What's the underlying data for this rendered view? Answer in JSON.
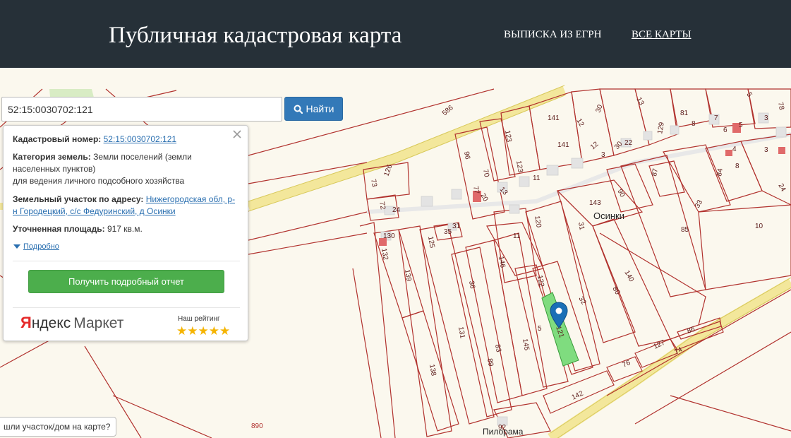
{
  "header": {
    "title": "Публичная кадастровая карта",
    "nav": {
      "egrn": "ВЫПИСКА ИЗ ЕГРН",
      "all_maps": "ВСЕ КАРТЫ"
    }
  },
  "search": {
    "value": "52:15:0030702:121",
    "button": "Найти"
  },
  "popup": {
    "cadastral_label": "Кадастровый номер:",
    "cadastral_value": "52:15:0030702:121",
    "category_label": "Категория земель:",
    "category_value": "Земли поселений (земли населенных пунктов)",
    "category_use": "для ведения личного подсобного хозяйства",
    "address_label": "Земельный участок по адресу:",
    "address_value": "Нижегородская обл, р-н Городецкий, с/с Федуринский, д Осинки",
    "area_label": "Уточненная площадь:",
    "area_value": "917 кв.м.",
    "more": "Подробно",
    "report_button": "Получить подробный отчет",
    "ym_y": "Я",
    "ym_ndex": "ндекс",
    "ym_market": "Маркет",
    "rating_label": "Наш рейтинг",
    "stars": "★★★★★"
  },
  "map": {
    "settlement": "Осинки",
    "pilorama": "Пилорама",
    "hint": "шли участок/дом на карте?",
    "bottom_number": "890",
    "parcel_labels": [
      "586",
      "141",
      "12",
      "30",
      "13",
      "5",
      "78",
      "81",
      "7",
      "5",
      "3",
      "129",
      "8",
      "6",
      "123",
      "141",
      "12",
      "13",
      "30",
      "22",
      "4",
      "8",
      "3",
      "96",
      "70",
      "123",
      "11",
      "87",
      "84",
      "24",
      "126",
      "73",
      "77",
      "20",
      "13",
      "143",
      "90",
      "72",
      "24",
      "120",
      "11",
      "31",
      "33",
      "85",
      "10",
      "35",
      "31",
      "125",
      "130",
      "132",
      "139",
      "146",
      "122",
      "36",
      "140",
      "80",
      "32",
      "131",
      "138",
      "83",
      "89",
      "5",
      "145",
      "121",
      "86",
      "74",
      "127",
      "76",
      "142",
      "92"
    ]
  },
  "colors": {
    "header_bg": "#263038",
    "parcel_line": "#b1322e",
    "selected_parcel": "#7fdc7f",
    "road": "#f5eca3",
    "button_blue": "#3379b8",
    "button_green": "#4cae4c"
  }
}
